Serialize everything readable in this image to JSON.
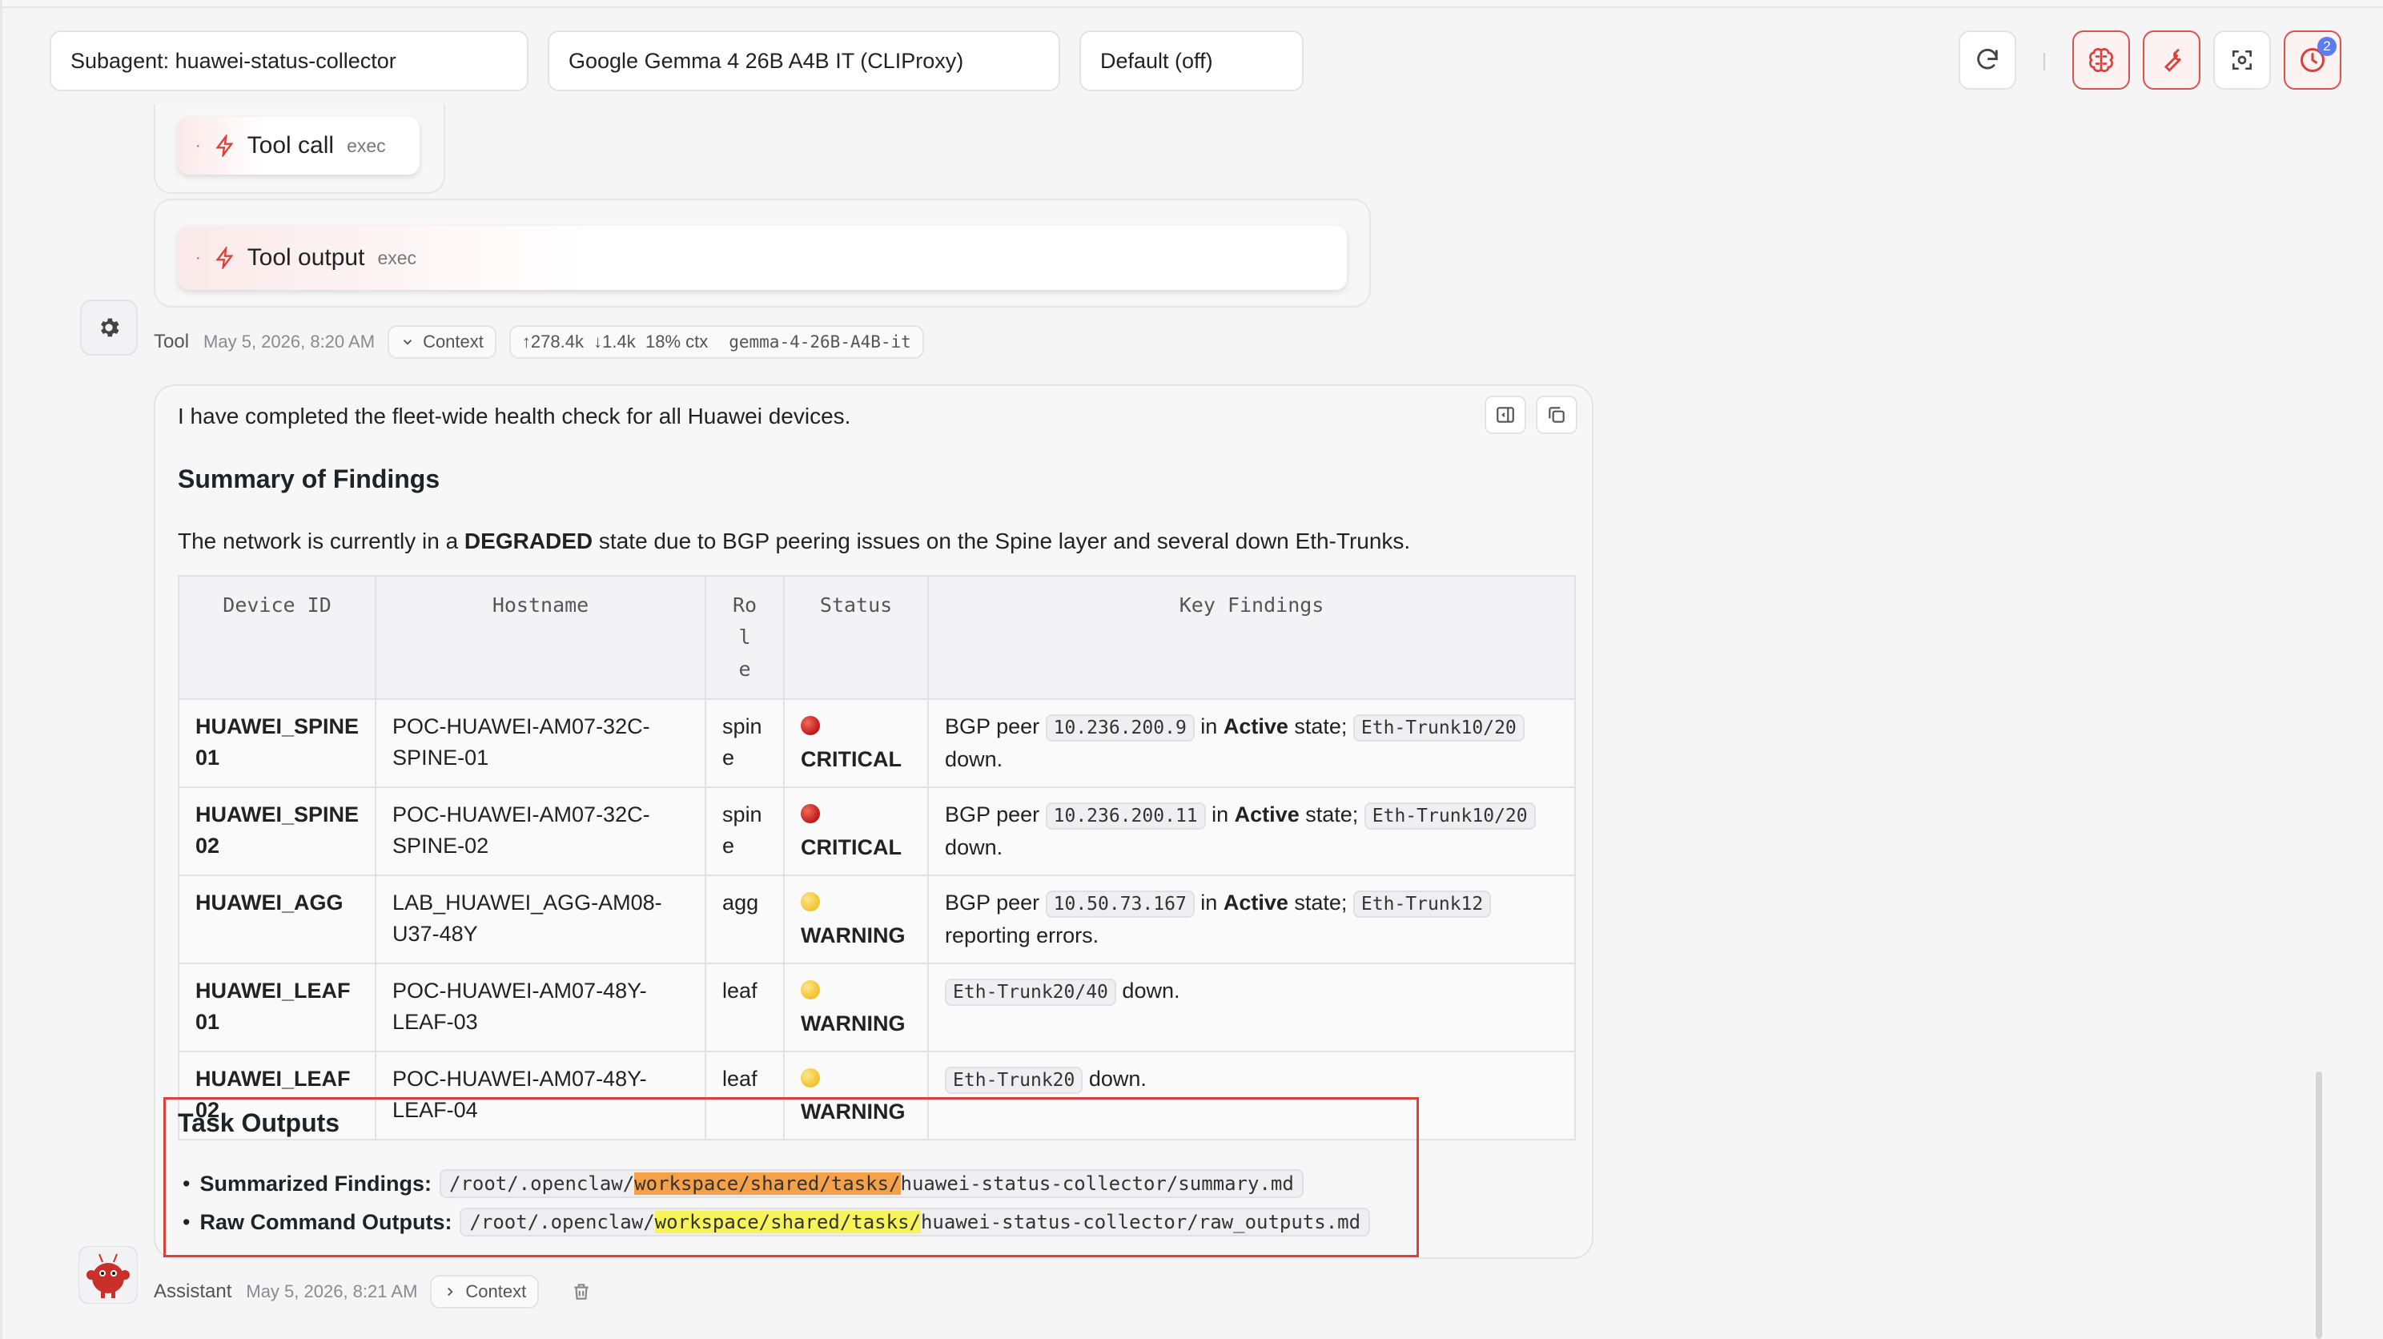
{
  "topbar": {
    "subagent": "Subagent: huawei-status-collector",
    "model": "Google Gemma 4 26B A4B IT (CLIProxy)",
    "thinking": "Default (off)",
    "sep": "|",
    "notification_count": "2"
  },
  "tool_cards": {
    "call_label": "Tool call",
    "call_sub": "exec",
    "output_label": "Tool output",
    "output_sub": "exec",
    "bullet": "·"
  },
  "tool_meta": {
    "who": "Tool",
    "time": "May 5, 2026, 8:20 AM",
    "context": "Context",
    "usage": "↑278.4k  ↓1.4k  18% ctx",
    "model": "gemma-4-26B-A4B-it"
  },
  "message": {
    "intro": "I have completed the fleet-wide health check for all Huawei devices.",
    "summary_heading": "Summary of Findings",
    "state_pre": "The network is currently in a ",
    "state_word": "DEGRADED",
    "state_post": " state due to BGP peering issues on the Spine layer and several down Eth-Trunks.",
    "table": {
      "headers": [
        "Device ID",
        "Hostname",
        "Rol e",
        "Status",
        "Key Findings"
      ],
      "rows": [
        {
          "id": "HUAWEI_SPINE 01",
          "host": "POC-HUAWEI-AM07-32C-SPINE-01",
          "role": "spin e",
          "status": "CRITICAL",
          "f_pre": "BGP peer ",
          "f_code1": "10.236.200.9",
          "f_mid": " in ",
          "f_bold": "Active",
          "f_mid2": " state; ",
          "f_code2": "Eth-Trunk10/20",
          "f_post": " down."
        },
        {
          "id": "HUAWEI_SPINE 02",
          "host": "POC-HUAWEI-AM07-32C-SPINE-02",
          "role": "spin e",
          "status": "CRITICAL",
          "f_pre": "BGP peer ",
          "f_code1": "10.236.200.11",
          "f_mid": " in ",
          "f_bold": "Active",
          "f_mid2": " state; ",
          "f_code2": "Eth-Trunk10/20",
          "f_post": " down."
        },
        {
          "id": "HUAWEI_AGG",
          "host": "LAB_HUAWEI_AGG-AM08-U37-48Y",
          "role": "agg",
          "status": "WARNING",
          "f_pre": "BGP peer ",
          "f_code1": "10.50.73.167",
          "f_mid": " in ",
          "f_bold": "Active",
          "f_mid2": " state; ",
          "f_code2": "Eth-Trunk12",
          "f_post": " reporting errors."
        },
        {
          "id": "HUAWEI_LEAF 01",
          "host": "POC-HUAWEI-AM07-48Y-LEAF-03",
          "role": "leaf",
          "status": "WARNING",
          "f_code1": "Eth-Trunk20/40",
          "f_post": " down."
        },
        {
          "id": "HUAWEI_LEAF 02",
          "host": "POC-HUAWEI-AM07-48Y-LEAF-04",
          "role": "leaf",
          "status": "WARNING",
          "f_code1": "Eth-Trunk20",
          "f_post": " down."
        }
      ]
    },
    "outputs_heading": "Task Outputs",
    "outputs": [
      {
        "label": "Summarized Findings:",
        "p1": "/root/.openclaw/",
        "p2": "workspace/shared/tasks/",
        "p3": "huawei-status-collector/summary.md"
      },
      {
        "label": "Raw Command Outputs:",
        "p1": "/root/.openclaw/",
        "p2": "workspace/shared/tasks/",
        "p3": "huawei-status-collector/raw_outputs.md"
      }
    ]
  },
  "assistant_meta": {
    "who": "Assistant",
    "time": "May 5, 2026, 8:21 AM",
    "context": "Context"
  },
  "colors": {
    "accent_red": "#d9413a",
    "critical": "#c0181a",
    "warning": "#f2c12e",
    "highlight_orange": "#f5a14a",
    "highlight_yellow": "#f7f35a"
  }
}
